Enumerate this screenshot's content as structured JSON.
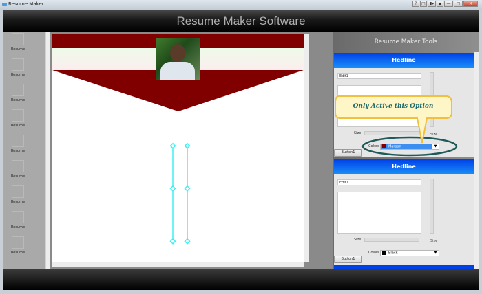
{
  "window": {
    "title": "Resume Maker",
    "controls": [
      "?",
      "□",
      "▮▸",
      "▪",
      "—",
      "□",
      "✕"
    ]
  },
  "header": {
    "title": "Resume Maker Software"
  },
  "templates": {
    "items": [
      "Resume",
      "Resume",
      "Resume",
      "Resume",
      "Resume",
      "Resume",
      "Resume",
      "Resume",
      "Resume"
    ]
  },
  "canvas": {
    "header_color": "#800000",
    "photo": "profile-photo"
  },
  "tools": {
    "title": "Resume Maker Tools",
    "sections": [
      {
        "heading": "Hedline",
        "edit_value": "Edit1",
        "size_label": "Size",
        "size_label_vertical": "Size",
        "colors_label": "Colors",
        "color_value": "Maroon",
        "color_swatch": "#800000",
        "button_label": "Button1"
      },
      {
        "heading": "Hedline",
        "edit_value": "Edit1",
        "size_label": "Size",
        "size_label_vertical": "Size",
        "colors_label": "Colors",
        "color_value": "Black",
        "color_swatch": "#000000",
        "button_label": "Button1"
      }
    ]
  },
  "annotation": {
    "callout_text": "Only Active  this Option"
  }
}
